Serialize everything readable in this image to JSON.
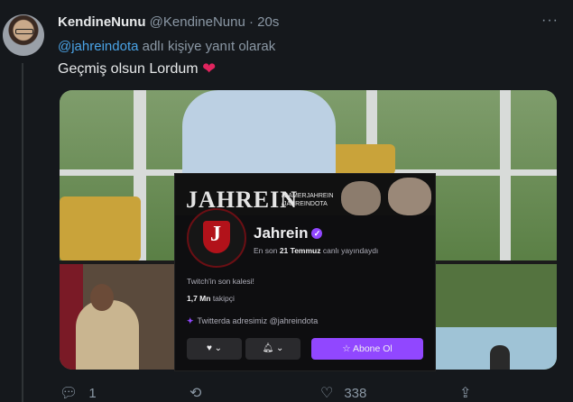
{
  "tweet": {
    "display_name": "KendineNunu",
    "handle": "@KendineNunu",
    "separator": "·",
    "time": "20s",
    "more": "···",
    "reply_mention": "@jahreindota",
    "reply_suffix": " adlı kişiye yanıt olarak",
    "text": "Geçmiş olsun Lordum",
    "emoji": "❤",
    "reply_count": "1",
    "retweet_count": "",
    "like_count": "338"
  },
  "twitch_card": {
    "banner_title": "JAHREIN",
    "banner_social_1": "/GAMERJAHREIN",
    "banner_social_2": "/JAHREINDOTA",
    "logo_letter": "J",
    "channel_name": "Jahrein",
    "verified_glyph": "✓",
    "live_prefix": "En son ",
    "live_date": "21 Temmuz",
    "live_suffix": " canlı yayındaydı",
    "bio": "Twitch'in son kalesi!",
    "followers_count": "1,7 Mn",
    "followers_label": " takipçi",
    "twitter_text": "Twitterda adresimiz @jahreindota",
    "heart_button": "♥ ⌄",
    "bell_button": "🔔︎ ⌄",
    "subscribe_label": "☆ Abone Ol"
  },
  "icons": {
    "reply": "reply-icon",
    "retweet": "retweet-icon",
    "like": "like-icon",
    "share": "share-icon"
  },
  "colors": {
    "background": "#15181c",
    "mention": "#4aa3e6",
    "twitch_purple": "#9147ff",
    "heart": "#e0245e"
  }
}
